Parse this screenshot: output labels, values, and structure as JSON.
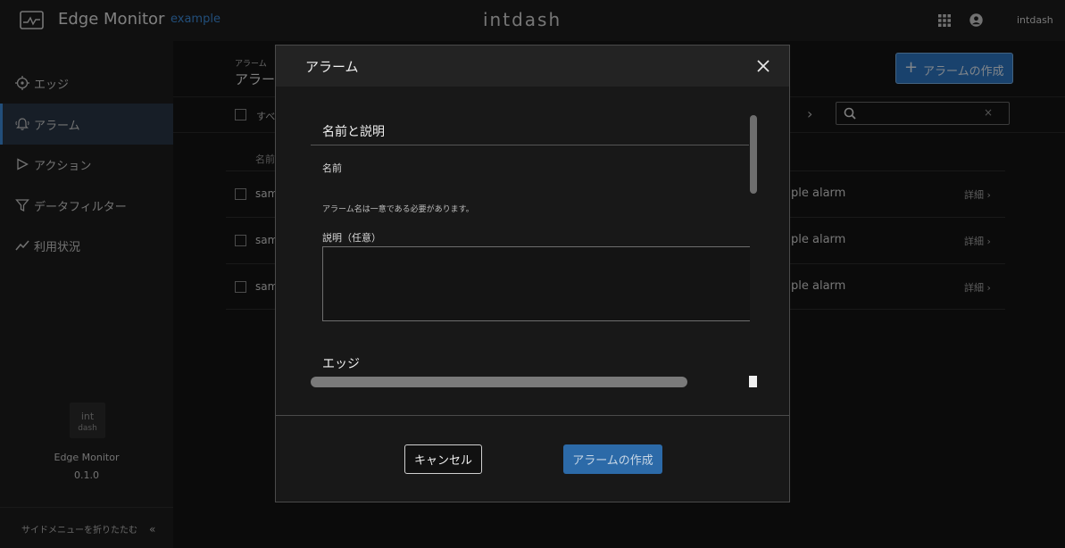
{
  "header": {
    "app_title": "Edge Monitor",
    "project": "example",
    "brand": "intdash",
    "user_name": "intdash",
    "apps_icon": "grid-icon",
    "user_icon": "user-circle-icon"
  },
  "sidebar": {
    "items": [
      {
        "label": "エッジ",
        "icon": "crosshair-icon"
      },
      {
        "label": "アラーム",
        "icon": "bell-icon"
      },
      {
        "label": "アクション",
        "icon": "play-icon"
      },
      {
        "label": "データフィルター",
        "icon": "filter-icon"
      },
      {
        "label": "利用状況",
        "icon": "trend-icon"
      }
    ],
    "active_index": 1,
    "app_name": "Edge Monitor",
    "version": "0.1.0",
    "logo_text": [
      "int",
      "dash"
    ],
    "collapse_label": "サイドメニューを折りたたむ",
    "collapse_icon": "«"
  },
  "main": {
    "breadcrumb": "アラーム",
    "page_title": "アラー",
    "create_button": "アラームの作成",
    "select_all_label": "すべ",
    "column_name": "名前",
    "rows": [
      {
        "name": "sam",
        "description": "ple alarm",
        "detail": "詳細 ›"
      },
      {
        "name": "sam",
        "description": "ple alarm",
        "detail": "詳細 ›"
      },
      {
        "name": "sam",
        "description": "ple alarm",
        "detail": "詳細 ›"
      }
    ],
    "search_placeholder": "",
    "search_clear": "×"
  },
  "modal": {
    "title": "アラーム",
    "section_title": "名前と説明",
    "name_label": "名前",
    "name_value": "",
    "name_hint": "アラーム名は一意である必要があります。",
    "description_label": "説明（任意）",
    "description_value": "",
    "edge_title": "エッジ",
    "cancel_button": "キャンセル",
    "submit_button": "アラームの作成"
  },
  "colors": {
    "accent": "#3e8ede",
    "primary_button": "#2f79c7",
    "background": "#141414",
    "panel": "#1e1e1e"
  }
}
